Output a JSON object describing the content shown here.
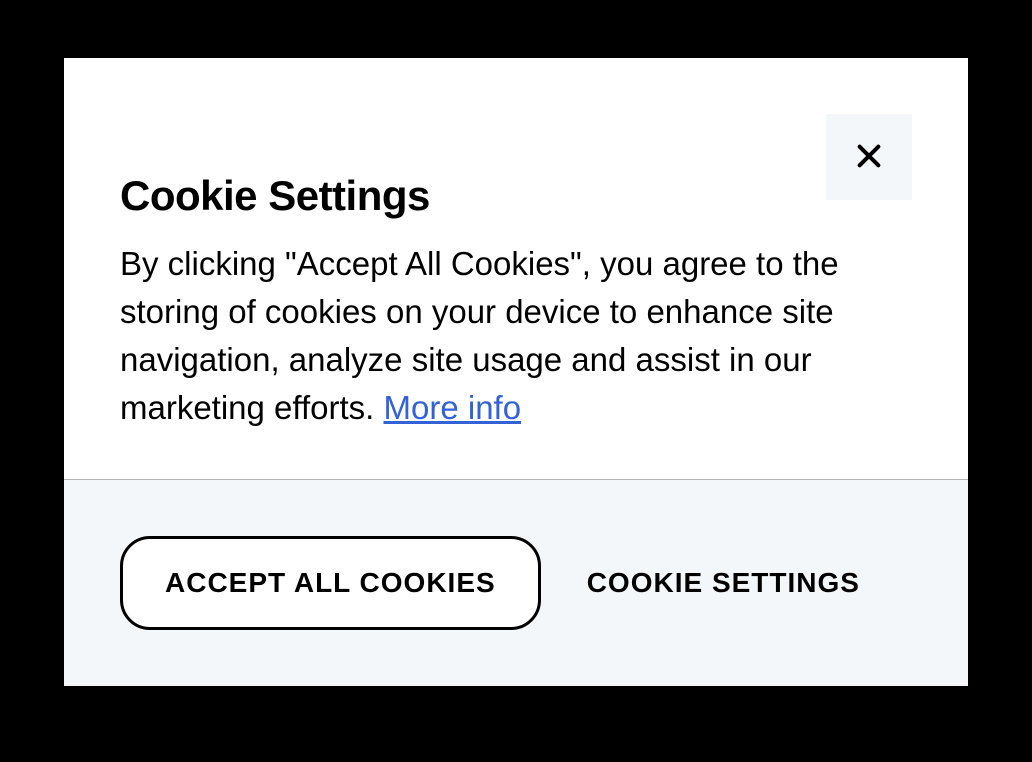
{
  "modal": {
    "title": "Cookie Settings",
    "description_part1": "By clicking \"Accept All Cookies\", you agree to the storing of cookies on your device to enhance site navigation, analyze site usage and assist in our marketing efforts. ",
    "more_info_label": "More info",
    "accept_button_label": "ACCEPT ALL COOKIES",
    "settings_button_label": "COOKIE SETTINGS"
  }
}
